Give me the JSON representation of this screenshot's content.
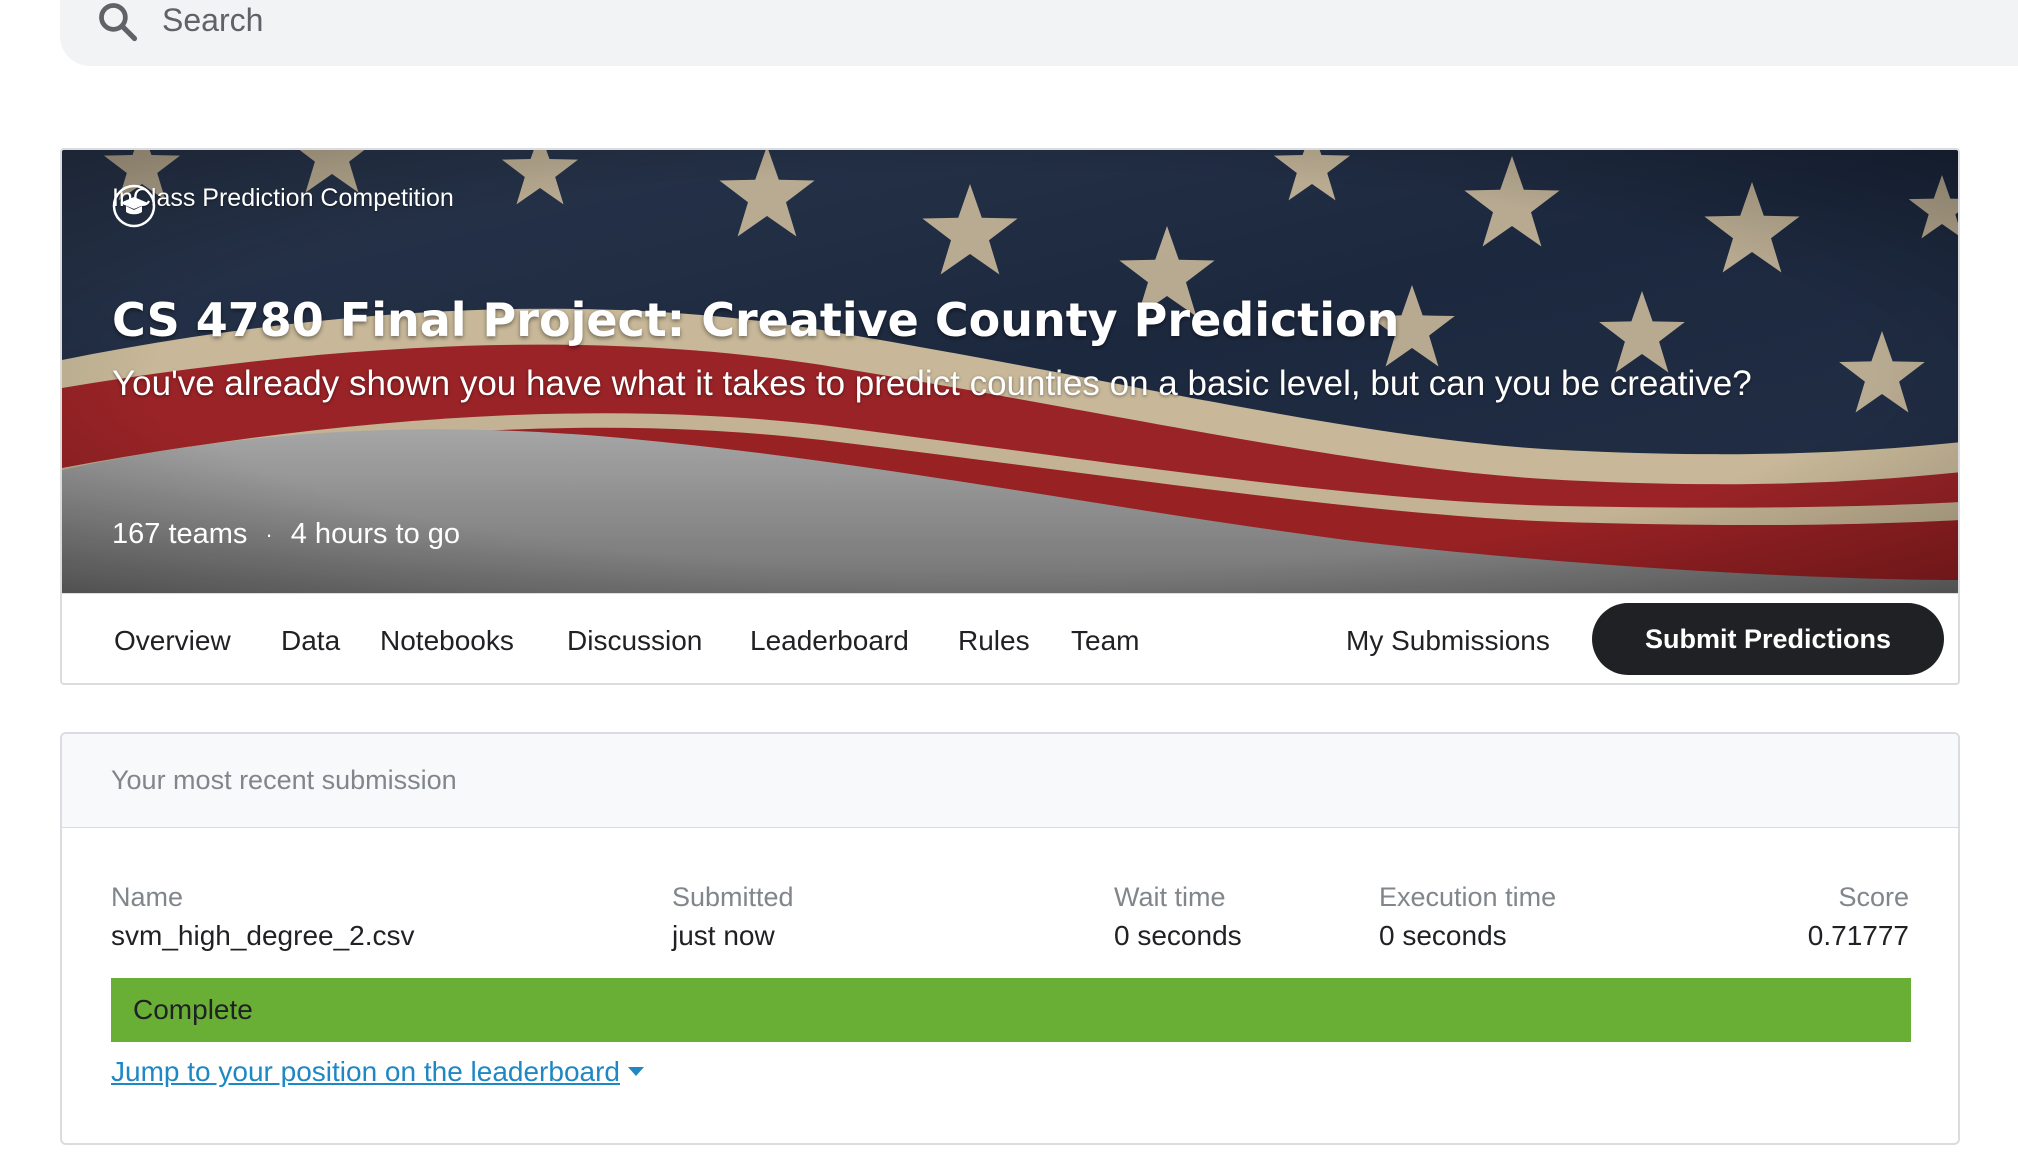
{
  "search": {
    "placeholder": "Search"
  },
  "header": {
    "competition_type": "InClass Prediction Competition",
    "title": "CS 4780 Final Project: Creative County Prediction",
    "subtitle": "You've already shown you have what it takes to predict counties on a basic level, but can you be creative?",
    "teams": "167 teams",
    "separator": "·",
    "time_left": "4 hours to go"
  },
  "tabs": [
    {
      "label": "Overview"
    },
    {
      "label": "Data"
    },
    {
      "label": "Notebooks"
    },
    {
      "label": "Discussion"
    },
    {
      "label": "Leaderboard"
    },
    {
      "label": "Rules"
    },
    {
      "label": "Team"
    }
  ],
  "actions": {
    "my_submissions": "My Submissions",
    "submit_predictions": "Submit Predictions"
  },
  "submission": {
    "heading": "Your most recent submission",
    "columns": {
      "name": {
        "label": "Name",
        "value": "svm_high_degree_2.csv"
      },
      "submitted": {
        "label": "Submitted",
        "value": "just now"
      },
      "wait_time": {
        "label": "Wait time",
        "value": "0 seconds"
      },
      "execution_time": {
        "label": "Execution time",
        "value": "0 seconds"
      },
      "score": {
        "label": "Score",
        "value": "0.71777"
      }
    },
    "status": "Complete",
    "jump_link": "Jump to your position on the leaderboard"
  },
  "colors": {
    "status_complete": "#6aaf35",
    "link": "#1e88c4",
    "button_bg": "#202124"
  },
  "icons": [
    "search-icon",
    "graduation-cap-icon",
    "caret-down-icon"
  ]
}
